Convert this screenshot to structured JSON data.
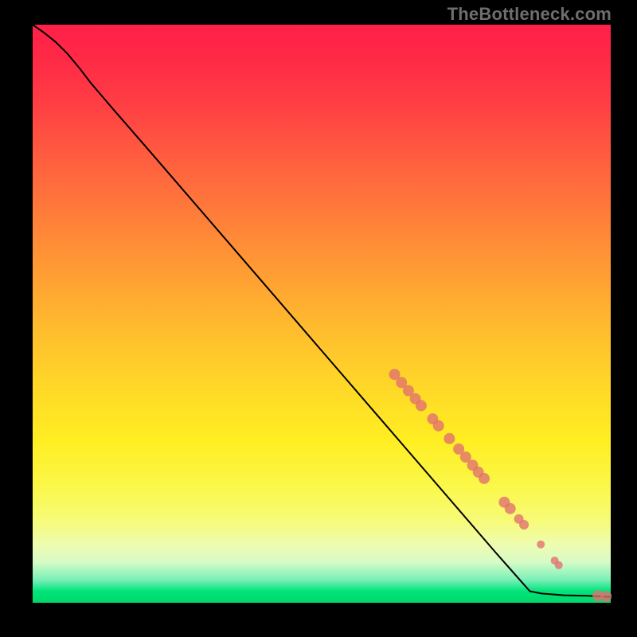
{
  "watermark": "TheBottleneck.com",
  "colors": {
    "point": "#e07070",
    "curve": "#000000"
  },
  "chart_data": {
    "type": "line",
    "title": "",
    "xlabel": "",
    "ylabel": "",
    "xlim": [
      0,
      100
    ],
    "ylim": [
      0,
      100
    ],
    "grid": false,
    "legend": false,
    "curve": [
      {
        "x": 0.0,
        "y": 100.0
      },
      {
        "x": 2.0,
        "y": 98.6
      },
      {
        "x": 4.0,
        "y": 97.0
      },
      {
        "x": 6.0,
        "y": 95.0
      },
      {
        "x": 8.0,
        "y": 92.6
      },
      {
        "x": 10.0,
        "y": 90.0
      },
      {
        "x": 14.0,
        "y": 85.3
      },
      {
        "x": 20.0,
        "y": 78.4
      },
      {
        "x": 30.0,
        "y": 66.8
      },
      {
        "x": 40.0,
        "y": 55.2
      },
      {
        "x": 50.0,
        "y": 43.6
      },
      {
        "x": 60.0,
        "y": 32.0
      },
      {
        "x": 70.0,
        "y": 20.4
      },
      {
        "x": 80.0,
        "y": 8.8
      },
      {
        "x": 86.0,
        "y": 2.0
      },
      {
        "x": 88.0,
        "y": 1.6
      },
      {
        "x": 92.0,
        "y": 1.3
      },
      {
        "x": 96.0,
        "y": 1.2
      },
      {
        "x": 100.0,
        "y": 1.0
      }
    ],
    "points": [
      {
        "x": 62.6,
        "y": 39.5,
        "r": 7
      },
      {
        "x": 63.8,
        "y": 38.1,
        "r": 7
      },
      {
        "x": 65.0,
        "y": 36.7,
        "r": 7
      },
      {
        "x": 66.2,
        "y": 35.3,
        "r": 7
      },
      {
        "x": 67.2,
        "y": 34.1,
        "r": 7
      },
      {
        "x": 69.2,
        "y": 31.8,
        "r": 7
      },
      {
        "x": 70.2,
        "y": 30.6,
        "r": 7
      },
      {
        "x": 72.1,
        "y": 28.4,
        "r": 7
      },
      {
        "x": 73.7,
        "y": 26.6,
        "r": 7
      },
      {
        "x": 74.9,
        "y": 25.2,
        "r": 7
      },
      {
        "x": 76.1,
        "y": 23.8,
        "r": 7
      },
      {
        "x": 77.1,
        "y": 22.6,
        "r": 7
      },
      {
        "x": 78.1,
        "y": 21.5,
        "r": 7
      },
      {
        "x": 81.6,
        "y": 17.4,
        "r": 7
      },
      {
        "x": 82.6,
        "y": 16.3,
        "r": 7
      },
      {
        "x": 84.1,
        "y": 14.5,
        "r": 6
      },
      {
        "x": 85.0,
        "y": 13.5,
        "r": 6
      },
      {
        "x": 87.9,
        "y": 10.1,
        "r": 5
      },
      {
        "x": 90.3,
        "y": 7.3,
        "r": 5
      },
      {
        "x": 91.0,
        "y": 6.5,
        "r": 5
      },
      {
        "x": 97.8,
        "y": 1.2,
        "r": 7
      },
      {
        "x": 99.2,
        "y": 1.1,
        "r": 7
      }
    ]
  }
}
